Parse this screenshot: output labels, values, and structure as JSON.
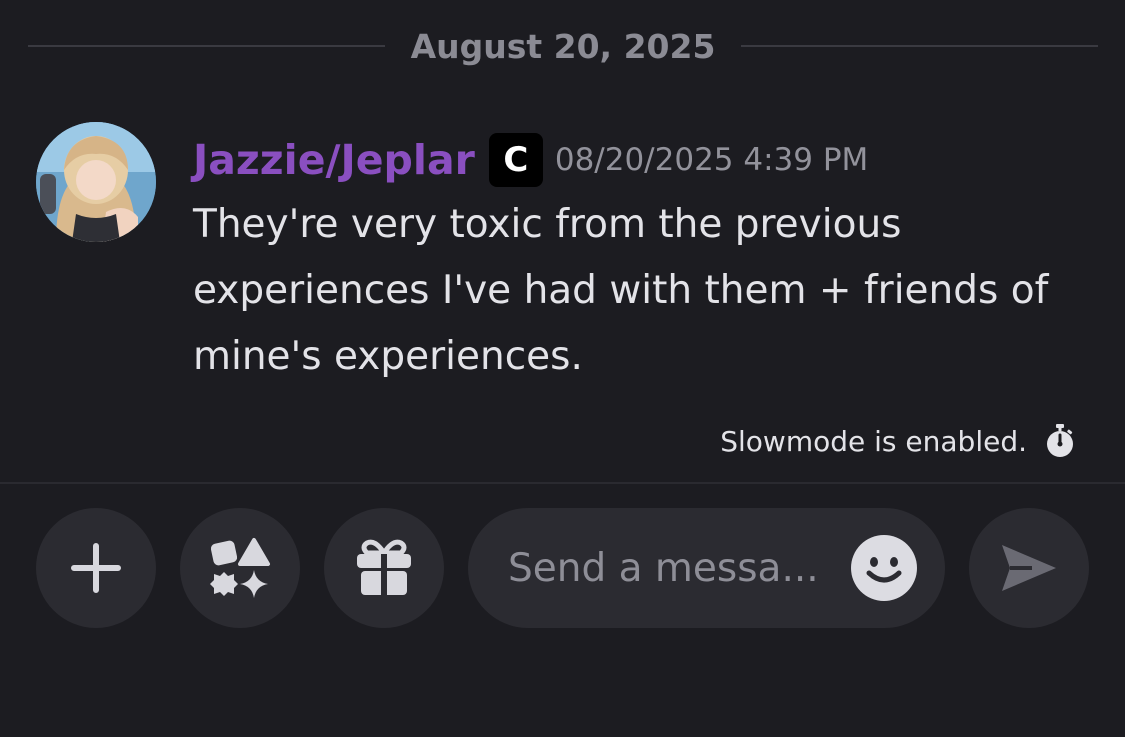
{
  "date_divider": {
    "label": "August 20, 2025"
  },
  "message": {
    "username": "Jazzie/Jeplar",
    "username_color": "#8a4fc0",
    "tag_badge": "C",
    "timestamp": "08/20/2025 4:39 PM",
    "text": "They're very toxic from the previous experiences I've had with them + friends of mine's experiences."
  },
  "slowmode": {
    "text": "Slowmode is enabled.",
    "icon": "stopwatch-icon"
  },
  "composer": {
    "placeholder": "Send a messa...",
    "buttons": {
      "add": "plus-icon",
      "apps": "apps-icon",
      "gift": "gift-icon",
      "emoji": "smiley-icon",
      "send": "send-icon"
    }
  },
  "colors": {
    "background": "#1c1c21",
    "button_bg": "#2b2b31",
    "muted_text": "#8b8b94"
  }
}
